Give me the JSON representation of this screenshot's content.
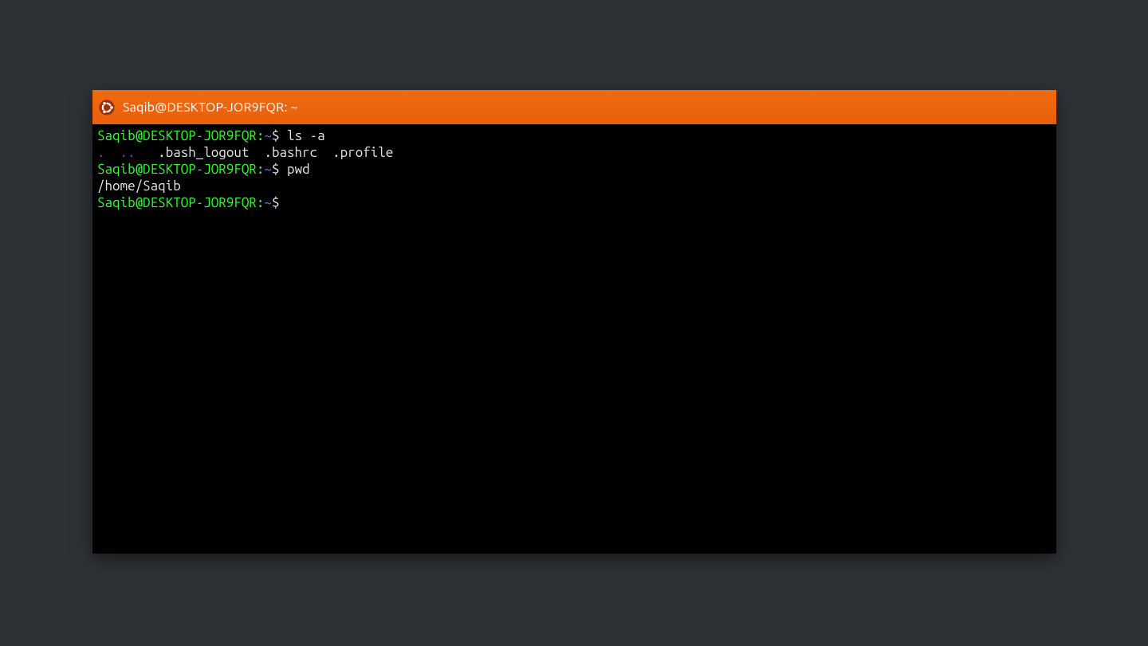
{
  "title": "Saqib@DESKTOP-JOR9FQR: ~",
  "prompt": {
    "user_host": "Saqib@DESKTOP-JOR9FQR",
    "sep": ":",
    "path": "~",
    "symbol": "$"
  },
  "session": {
    "cmd1": "ls -a",
    "ls_output_dots": ".  ..",
    "ls_output_files": "   .bash_logout  .bashrc  .profile",
    "cmd2": "pwd",
    "pwd_output": "/home/Saqib",
    "cmd3": ""
  }
}
